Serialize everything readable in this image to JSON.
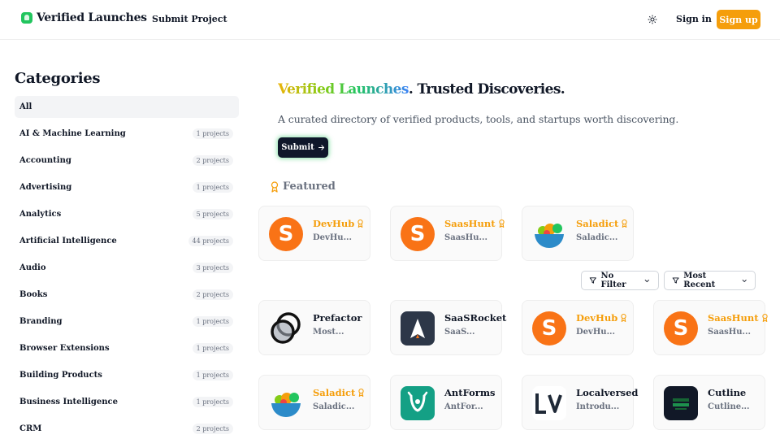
{
  "header": {
    "brand": "Verified Launches",
    "nav_submit": "Submit Project",
    "signin": "Sign in",
    "signup": "Sign up"
  },
  "sidebar": {
    "title": "Categories",
    "items": [
      {
        "label": "All",
        "count": "",
        "active": true
      },
      {
        "label": "AI & Machine Learning",
        "count": "1 projects"
      },
      {
        "label": "Accounting",
        "count": "2 projects"
      },
      {
        "label": "Advertising",
        "count": "1 projects"
      },
      {
        "label": "Analytics",
        "count": "5 projects"
      },
      {
        "label": "Artificial Intelligence",
        "count": "44 projects"
      },
      {
        "label": "Audio",
        "count": "3 projects"
      },
      {
        "label": "Books",
        "count": "2 projects"
      },
      {
        "label": "Branding",
        "count": "1 projects"
      },
      {
        "label": "Browser Extensions",
        "count": "1 projects"
      },
      {
        "label": "Building Products",
        "count": "1 projects"
      },
      {
        "label": "Business Intelligence",
        "count": "1 projects"
      },
      {
        "label": "CRM",
        "count": "2 projects"
      }
    ]
  },
  "hero": {
    "title_highlight": "Verified Launches",
    "title_rest": ". Trusted Discoveries.",
    "subtitle": "A curated directory of verified products, tools, and startups worth discovering.",
    "button": "Submit"
  },
  "featured": {
    "label": "Featured",
    "cards": [
      {
        "name": "DevHub",
        "desc": "DevHu...",
        "icon": "devhub-logo-icon"
      },
      {
        "name": "SaasHunt",
        "desc": "SaasHu...",
        "icon": "saashunt-logo-icon"
      },
      {
        "name": "Saladict",
        "desc": "Saladic...",
        "icon": "saladict-logo-icon"
      }
    ]
  },
  "filters": {
    "filter": "No Filter",
    "sort": "Most Recent"
  },
  "projects": [
    {
      "name": "Prefactor",
      "desc": "Most...",
      "icon": "prefactor-logo-icon",
      "gold": false
    },
    {
      "name": "SaaSRocket",
      "desc": "SaaS...",
      "icon": "saasrocket-logo-icon",
      "gold": false
    },
    {
      "name": "DevHub",
      "desc": "DevHu...",
      "icon": "devhub-logo-icon",
      "gold": true
    },
    {
      "name": "SaasHunt",
      "desc": "SaasHu...",
      "icon": "saashunt-logo-icon",
      "gold": true
    },
    {
      "name": "Saladict",
      "desc": "Saladic...",
      "icon": "saladict-logo-icon",
      "gold": true
    },
    {
      "name": "AntForms",
      "desc": "AntFor...",
      "icon": "antforms-logo-icon",
      "gold": false
    },
    {
      "name": "Localversed",
      "desc": "Introdu...",
      "icon": "localversed-logo-icon",
      "gold": false
    },
    {
      "name": "Cutline",
      "desc": "Cutline...",
      "icon": "cutline-logo-icon",
      "gold": false
    }
  ],
  "colors": {
    "accent": "#f59e0b",
    "brand_green": "#22c55e",
    "logo_orange": "#f97316",
    "dark": "#0f172a"
  }
}
